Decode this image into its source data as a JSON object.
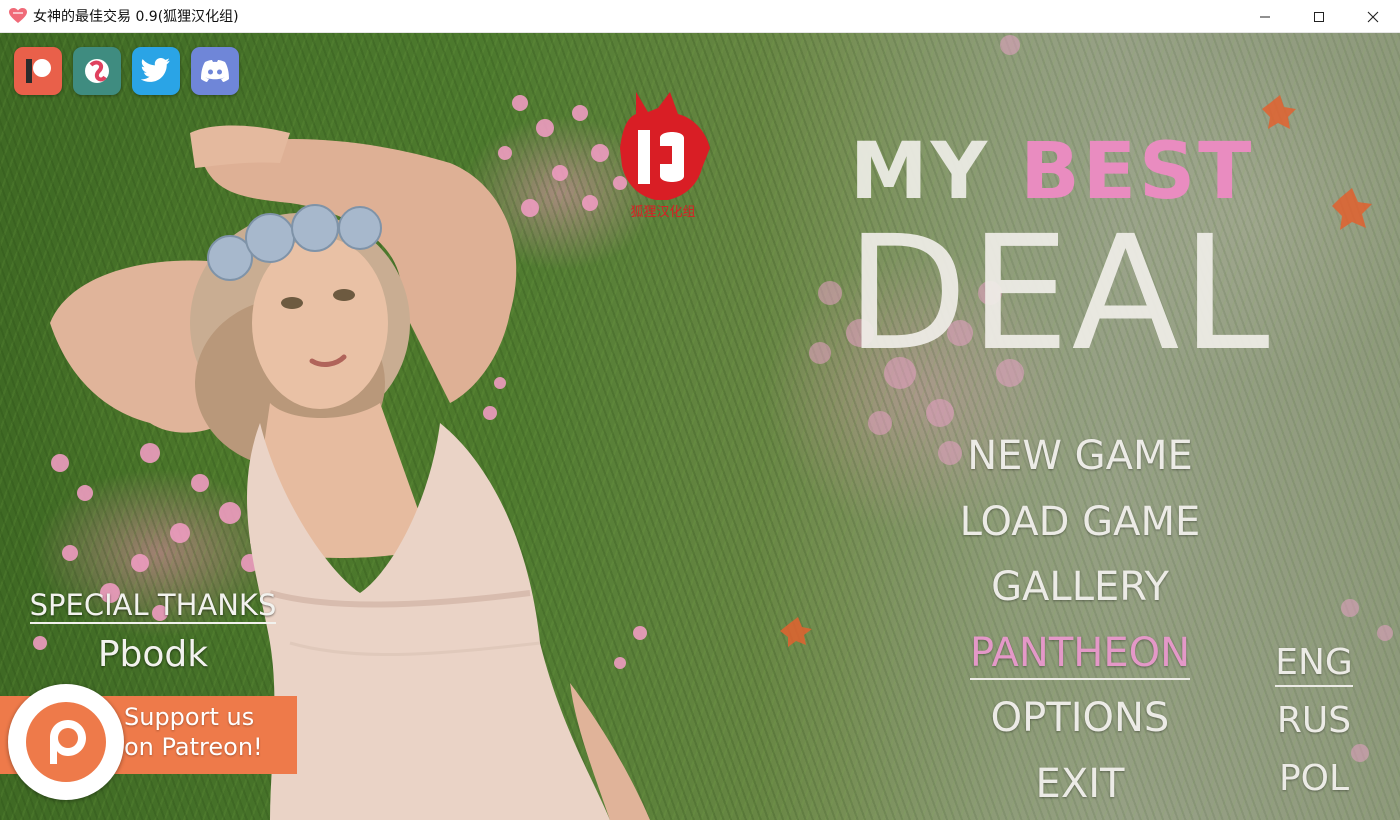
{
  "window": {
    "title": "女神的最佳交易 0.9(狐狸汉化组)",
    "minimize_icon": "minimize-icon",
    "maximize_icon": "maximize-icon",
    "close_icon": "close-icon"
  },
  "social": [
    {
      "name": "patreon",
      "icon": "patreon-icon",
      "color": "#e9604a"
    },
    {
      "name": "subscribestar",
      "icon": "subscribestar-icon",
      "color": "#3f8c80"
    },
    {
      "name": "twitter",
      "icon": "twitter-icon",
      "color": "#2aa4e6"
    },
    {
      "name": "discord",
      "icon": "discord-icon",
      "color": "#6f86d8"
    }
  ],
  "logo": {
    "icon": "fox-logo-icon",
    "text": "狐狸汉化组"
  },
  "game_title": {
    "line1_a": "MY",
    "line1_b": "BEST",
    "line2": "DEAL",
    "accent_color": "#e98cc0"
  },
  "menu": {
    "items": [
      {
        "label": "NEW GAME"
      },
      {
        "label": "LOAD GAME"
      },
      {
        "label": "GALLERY"
      },
      {
        "label": "PANTHEON",
        "active": true
      },
      {
        "label": "OPTIONS"
      },
      {
        "label": "EXIT"
      }
    ]
  },
  "language": {
    "items": [
      {
        "label": "ENG",
        "selected": true
      },
      {
        "label": "RUS"
      },
      {
        "label": "POL"
      }
    ]
  },
  "thanks": {
    "heading": "SPECIAL THANKS",
    "name": "Pbodk"
  },
  "patreon_banner": {
    "line1": "Support us",
    "line2": "on Patreon!",
    "color": "#ee7a4a"
  }
}
